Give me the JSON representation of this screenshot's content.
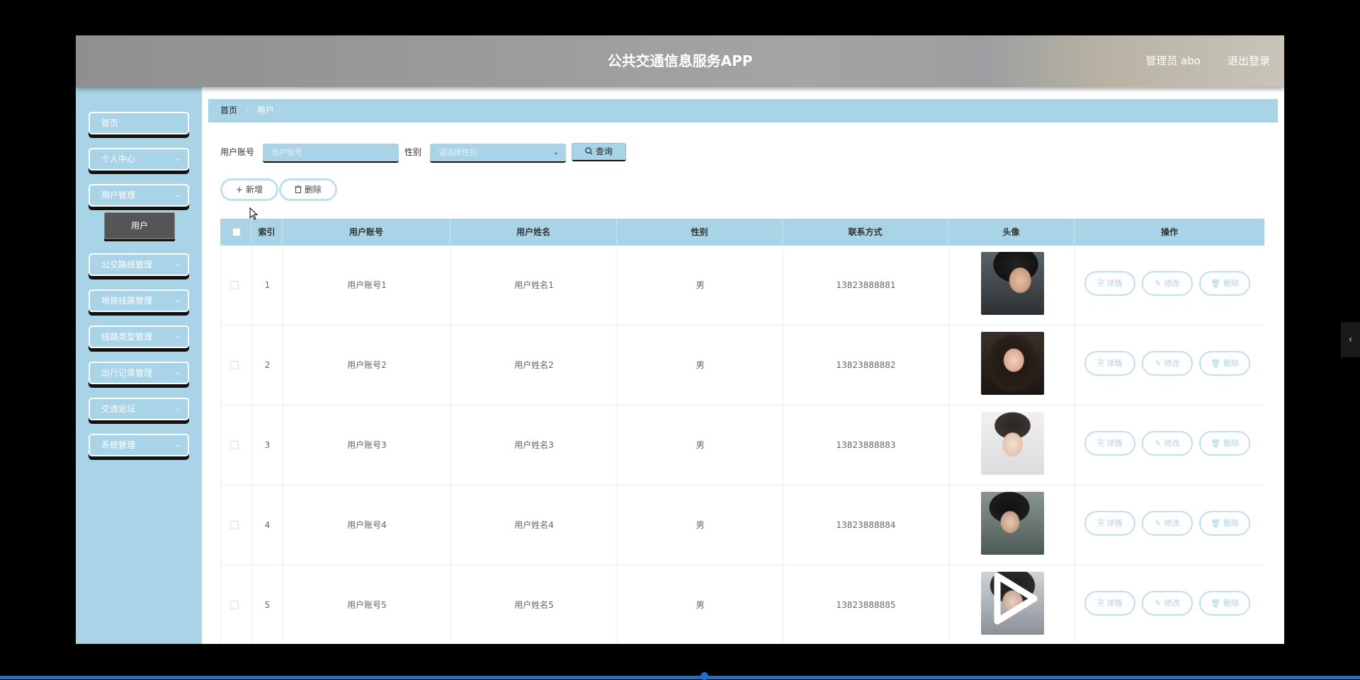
{
  "header": {
    "title": "公共交通信息服务APP",
    "admin": "管理员 abo",
    "logout": "退出登录"
  },
  "sidebar": {
    "items": [
      {
        "label": "首页",
        "chevron": false
      },
      {
        "label": "个人中心",
        "chevron": true
      },
      {
        "label": "用户管理",
        "chevron": true
      },
      {
        "label": "公交路线管理",
        "chevron": true
      },
      {
        "label": "地铁线路管理",
        "chevron": true
      },
      {
        "label": "线路类型管理",
        "chevron": true
      },
      {
        "label": "出行记录管理",
        "chevron": true
      },
      {
        "label": "交流论坛",
        "chevron": true
      },
      {
        "label": "系统管理",
        "chevron": true
      }
    ],
    "submenu": {
      "label": "用户"
    }
  },
  "breadcrumb": {
    "home": "首页",
    "current": "用户"
  },
  "search": {
    "account_label": "用户账号",
    "account_placeholder": "用户账号",
    "gender_label": "性别",
    "gender_placeholder": "请选择性别",
    "query_label": "查询"
  },
  "actions": {
    "add_label": "新增",
    "delete_label": "删除"
  },
  "table": {
    "columns": [
      "索引",
      "用户账号",
      "用户姓名",
      "性别",
      "联系方式",
      "头像",
      "操作"
    ],
    "rows": [
      {
        "index": "1",
        "account": "用户账号1",
        "name": "用户姓名1",
        "gender": "男",
        "phone": "13823888881"
      },
      {
        "index": "2",
        "account": "用户账号2",
        "name": "用户姓名2",
        "gender": "男",
        "phone": "13823888882"
      },
      {
        "index": "3",
        "account": "用户账号3",
        "name": "用户姓名3",
        "gender": "男",
        "phone": "13823888883"
      },
      {
        "index": "4",
        "account": "用户账号4",
        "name": "用户姓名4",
        "gender": "男",
        "phone": "13823888884"
      },
      {
        "index": "5",
        "account": "用户账号5",
        "name": "用户姓名5",
        "gender": "男",
        "phone": "13823888885"
      }
    ],
    "row_actions": {
      "detail": "详情",
      "edit": "修改",
      "delete": "删除"
    }
  },
  "colors": {
    "accent": "#a9d3e6",
    "header": "#9c9ea0",
    "progress": "#1f6fd0"
  }
}
